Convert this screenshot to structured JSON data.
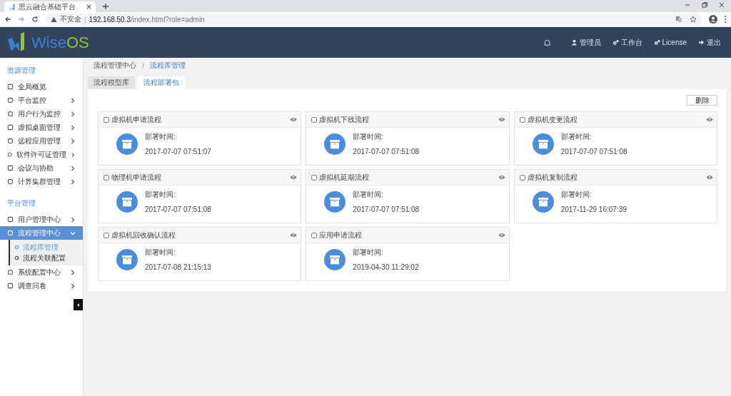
{
  "browser": {
    "tab_title": "思云融合基础平台",
    "security": "不安全",
    "divider": "|",
    "url_host": "192.168.50.3",
    "url_path": "/index.html?role=admin"
  },
  "header": {
    "logo_text": "Wise",
    "logo_accent": "OS",
    "nav": [
      {
        "kind": "bell"
      },
      {
        "kind": "user",
        "label": "管理员"
      },
      {
        "kind": "gears",
        "label": "工作台"
      },
      {
        "kind": "gears",
        "label": "License"
      },
      {
        "kind": "exit",
        "label": "退出"
      }
    ]
  },
  "sidebar": {
    "groups": [
      {
        "title": "资源管理",
        "items": [
          {
            "label": "全局概览",
            "has_arrow": false,
            "selected": false
          },
          {
            "label": "平台监控",
            "has_arrow": true,
            "expanded": false,
            "selected": false
          },
          {
            "label": "用户行为监控",
            "has_arrow": true,
            "expanded": false,
            "selected": false
          },
          {
            "label": "虚拟桌面管理",
            "has_arrow": true,
            "expanded": false,
            "selected": false
          },
          {
            "label": "远程应用管理",
            "has_arrow": true,
            "expanded": false,
            "selected": false
          },
          {
            "label": "软件许可证管理",
            "has_arrow": true,
            "expanded": false,
            "selected": false
          },
          {
            "label": "会议与协助",
            "has_arrow": true,
            "expanded": false,
            "selected": false
          },
          {
            "label": "计算集群管理",
            "has_arrow": true,
            "expanded": false,
            "selected": false
          }
        ]
      },
      {
        "title": "平台管理",
        "items": [
          {
            "label": "用户管理中心",
            "has_arrow": true,
            "expanded": false,
            "selected": false
          },
          {
            "label": "流程管理中心",
            "has_arrow": true,
            "expanded": true,
            "selected": true,
            "children": [
              {
                "label": "流程库管理",
                "selected": true
              },
              {
                "label": "流程关联配置",
                "selected": false
              }
            ]
          },
          {
            "label": "系统配置中心",
            "has_arrow": true,
            "expanded": false,
            "selected": false
          },
          {
            "label": "调查问卷",
            "has_arrow": true,
            "expanded": false,
            "selected": false
          }
        ]
      }
    ]
  },
  "breadcrumb": [
    "流程管理中心",
    "流程库管理"
  ],
  "breadcrumb_separator": "/",
  "tabs": [
    {
      "label": "流程模型库",
      "selected": false
    },
    {
      "label": "流程部署包",
      "selected": true
    }
  ],
  "delete_button": "删除",
  "cards": [
    {
      "title": "虚拟机申请流程",
      "checked": false,
      "label": "部署时间:",
      "time": "2017-07-07 07:51:07"
    },
    {
      "title": "虚拟机下线流程",
      "checked": false,
      "label": "部署时间:",
      "time": "2017-07-07 07:51:08"
    },
    {
      "title": "虚拟机变更流程",
      "checked": false,
      "label": "部署时间:",
      "time": "2017-07-07 07:51:08"
    },
    {
      "title": "物理机申请流程",
      "checked": false,
      "label": "部署时间:",
      "time": "2017-07-07 07:51:08"
    },
    {
      "title": "虚拟机延期流程",
      "checked": false,
      "label": "部署时间:",
      "time": "2017-07-07 07:51:08"
    },
    {
      "title": "虚拟机复制流程",
      "checked": false,
      "label": "部署时间:",
      "time": "2017-11-29 16:07:39"
    },
    {
      "title": "虚拟机回收确认流程",
      "checked": false,
      "label": "部署时间:",
      "time": "2017-07-08 21:15:13"
    },
    {
      "title": "应用申请流程",
      "checked": false,
      "label": "部署时间:",
      "time": "2019-04-30 11:29:02"
    }
  ]
}
